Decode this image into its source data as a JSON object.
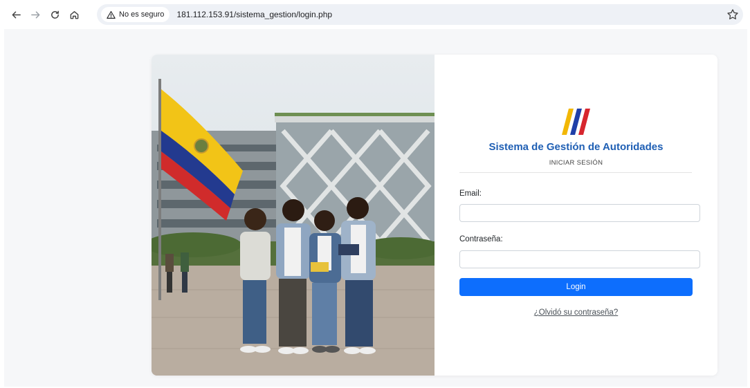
{
  "browser": {
    "security_label": "No es seguro",
    "url": "181.112.153.91/sistema_gestion/login.php"
  },
  "login": {
    "system_title": "Sistema de Gestión de Autoridades",
    "section_title": "INICIAR SESIÓN",
    "email_label": "Email:",
    "email_value": "",
    "password_label": "Contraseña:",
    "password_value": "",
    "login_button": "Login",
    "forgot_link": "¿Olvidó su contraseña?"
  },
  "colors": {
    "primary_button": "#0d6efd",
    "title_blue": "#1f5fb4",
    "logo_yellow": "#f2b705",
    "logo_blue": "#1f3fa8",
    "logo_red": "#d7262e"
  },
  "icons": [
    "back-arrow-icon",
    "forward-arrow-icon",
    "reload-icon",
    "home-icon",
    "warning-icon",
    "star-icon"
  ]
}
